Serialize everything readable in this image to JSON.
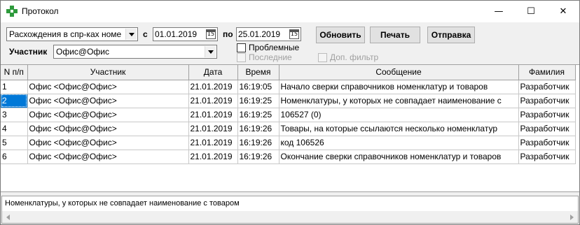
{
  "window": {
    "title": "Протокол",
    "icon": "green-cross-icon",
    "controls": {
      "minimize": "—",
      "maximize": "☐",
      "close": "✕"
    }
  },
  "filters": {
    "mode_select": "Расхождения в спр-ках номе",
    "from_label": "с",
    "from_date": "01.01.2019",
    "to_label": "по",
    "to_date": "25.01.2019",
    "participant_label": "Участник",
    "participant_value": "Офис@Офис",
    "calendar_glyph": "15"
  },
  "buttons": {
    "refresh": "Обновить",
    "print": "Печать",
    "send": "Отправка"
  },
  "checkboxes": {
    "problematic": "Проблемные",
    "recent": "Последние",
    "extra_filter": "Доп. фильтр"
  },
  "table": {
    "headers": [
      "N п/п",
      "Участник",
      "Дата",
      "Время",
      "Сообщение",
      "Фамилия"
    ],
    "rows": [
      [
        "1",
        "Офис <Офис@Офис>",
        "21.01.2019",
        "16:19:05",
        "Начало сверки справочников номенклатур и товаров",
        "Разработчик"
      ],
      [
        "2",
        "Офис <Офис@Офис>",
        "21.01.2019",
        "16:19:25",
        " Номенклатуры, у которых не совпадает наименование с",
        "Разработчик"
      ],
      [
        "3",
        "Офис <Офис@Офис>",
        "21.01.2019",
        "16:19:25",
        "106527 (0)",
        "Разработчик"
      ],
      [
        "4",
        "Офис <Офис@Офис>",
        "21.01.2019",
        "16:19:26",
        " Товары, на которые ссылаются несколько номенклатур",
        "Разработчик"
      ],
      [
        "5",
        "Офис <Офис@Офис>",
        "21.01.2019",
        "16:19:26",
        "код 106526",
        "Разработчик"
      ],
      [
        "6",
        "Офис <Офис@Офис>",
        "21.01.2019",
        "16:19:26",
        "Окончание сверки справочников номенклатур и товаров",
        "Разработчик"
      ]
    ],
    "selected_row": 2
  },
  "memo": {
    "text": "Номенклатуры, у которых не совпадает наименование с товаром"
  },
  "colors": {
    "selection": "#0078d7",
    "icon_green": "#2e9a3c"
  }
}
